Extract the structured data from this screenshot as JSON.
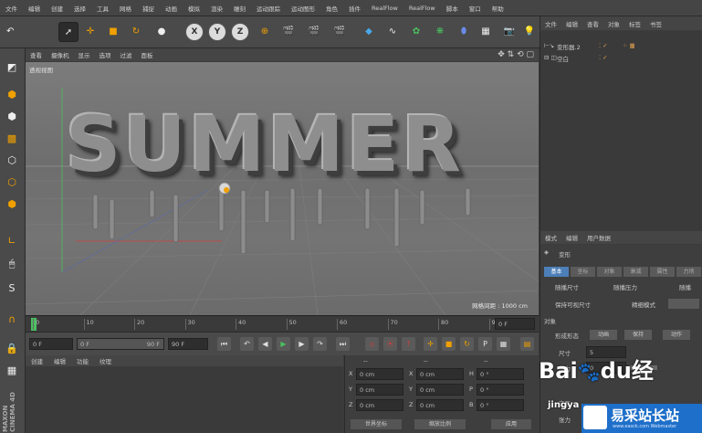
{
  "menubar": [
    "文件",
    "编辑",
    "创建",
    "选择",
    "工具",
    "网格",
    "捕捉",
    "动画",
    "模拟",
    "渲染",
    "雕刻",
    "运动跟踪",
    "运动图形",
    "角色",
    "插件",
    "RealFlow",
    "RealFlow",
    "脚本",
    "窗口",
    "帮助"
  ],
  "toolbar": {
    "axes": [
      "X",
      "Y",
      "Z"
    ]
  },
  "viewport": {
    "menu": [
      "查看",
      "摄像机",
      "显示",
      "选项",
      "过滤",
      "面板"
    ],
    "label": "透视视图",
    "text3d": "SUMMER",
    "grid_spacing": "网格间距 : 1000 cm"
  },
  "timeline": {
    "ticks": [
      "0",
      "10",
      "20",
      "30",
      "40",
      "50",
      "60",
      "70",
      "80",
      "90"
    ],
    "frame_end": "0 F"
  },
  "transport": {
    "start": "0 F",
    "min": "0 F",
    "max": "90 F",
    "end": "90 F"
  },
  "materials": {
    "menu": [
      "创建",
      "编辑",
      "功能",
      "纹理"
    ]
  },
  "coords": {
    "header": [
      "--",
      "--",
      "--"
    ],
    "rows": [
      {
        "a": "X",
        "av": "0 cm",
        "b": "X",
        "bv": "0 cm",
        "c": "H",
        "cv": "0 °"
      },
      {
        "a": "Y",
        "av": "0 cm",
        "b": "Y",
        "bv": "0 cm",
        "c": "P",
        "cv": "0 °"
      },
      {
        "a": "Z",
        "av": "0 cm",
        "b": "Z",
        "bv": "0 cm",
        "c": "B",
        "cv": "0 °"
      }
    ],
    "buttons": [
      "世界坐标",
      "缩放比例",
      "应用"
    ]
  },
  "objmgr": {
    "tabs": [
      "文件",
      "编辑",
      "查看",
      "对象",
      "标签",
      "书签"
    ],
    "objects": [
      "变形器.2",
      "空白"
    ]
  },
  "attr": {
    "tabs": [
      "模式",
      "编辑",
      "用户数据"
    ],
    "title": "变形",
    "subtabs": [
      "基本",
      "坐标",
      "对象",
      "衰减",
      "属性",
      "力场"
    ],
    "rows": [
      "随播尺寸",
      "随播压力",
      "保持可视尺寸",
      "精细模式"
    ],
    "extra_labels": [
      "随播"
    ],
    "section": "对象",
    "mode_label": "形成形态",
    "mode_buttons": [
      "动画",
      "保持",
      "动作"
    ],
    "size_label": "尺寸",
    "size_value": "5",
    "pressure_label": "压力",
    "pressure_value": "0",
    "extra": [
      "交互",
      "张力"
    ]
  },
  "watermark": {
    "baidu_a": "Bai",
    "baidu_b": "经",
    "baidu_c": "du",
    "jingyan": "jingya",
    "site": "易采站长站",
    "url": "www.easck.com Webmaster"
  },
  "brand": [
    "MAXON",
    "CINEMA 4D"
  ],
  "colors": {
    "accent": "#f0a000",
    "axis_x": "#d04040",
    "axis_y": "#40b040"
  }
}
